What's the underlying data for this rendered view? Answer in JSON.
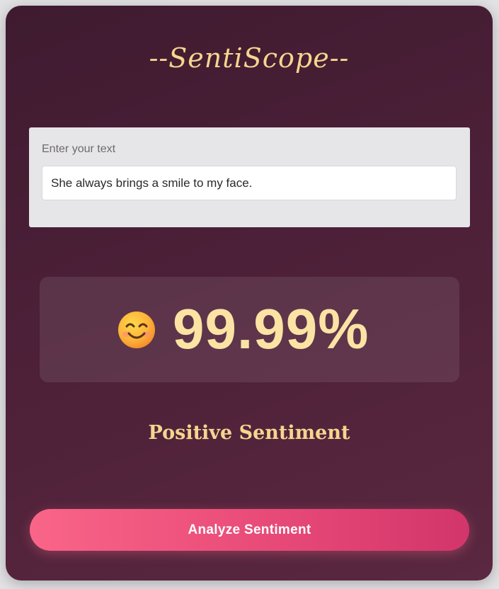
{
  "app": {
    "title": "--SentiScope--"
  },
  "input": {
    "label": "Enter your text",
    "value": "She always brings a smile to my face."
  },
  "result": {
    "emoji_icon": "smiling-face-icon",
    "score": "99.99%",
    "sentiment": "Positive Sentiment"
  },
  "actions": {
    "analyze_label": "Analyze Sentiment"
  },
  "colors": {
    "accent_gold": "#f6d58e",
    "button_pink": "#f96588",
    "card_bg": "#4c2038"
  }
}
